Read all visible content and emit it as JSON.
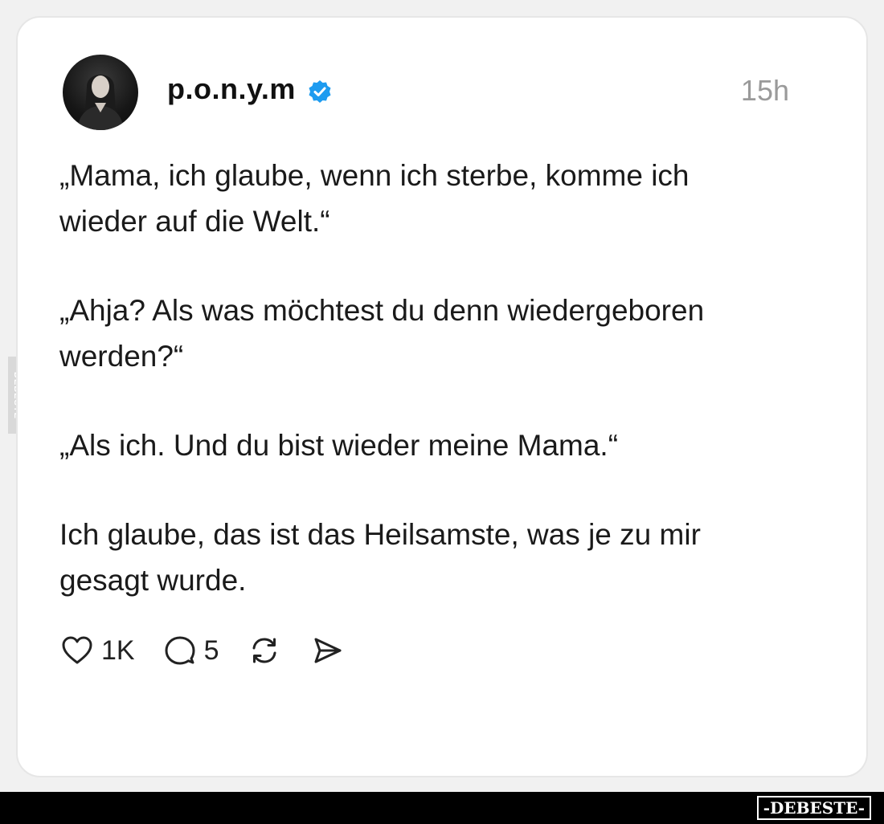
{
  "post": {
    "username": "p.o.n.y.m",
    "timestamp": "15h",
    "paragraphs": [
      "„Mama, ich glaube, wenn ich sterbe, komme ich wieder auf die Welt.“",
      "„Ahja? Als was möchtest du denn wiedergeboren werden?“",
      "„Als ich. Und du bist wieder meine Mama.“",
      "Ich glaube, das ist das Heilsamste, was je zu mir gesagt wurde."
    ],
    "likes": "1K",
    "replies": "5"
  },
  "icons": {
    "verified": "verified-badge-icon",
    "like": "heart-icon",
    "reply": "comment-icon",
    "repost": "repost-icon",
    "share": "send-icon"
  },
  "colors": {
    "verified": "#1d9bf0",
    "timestamp": "#9a9a9a",
    "text": "#1a1a1a"
  },
  "watermark": {
    "side": "DEBESTE",
    "footer": "-DEBESTE-"
  }
}
